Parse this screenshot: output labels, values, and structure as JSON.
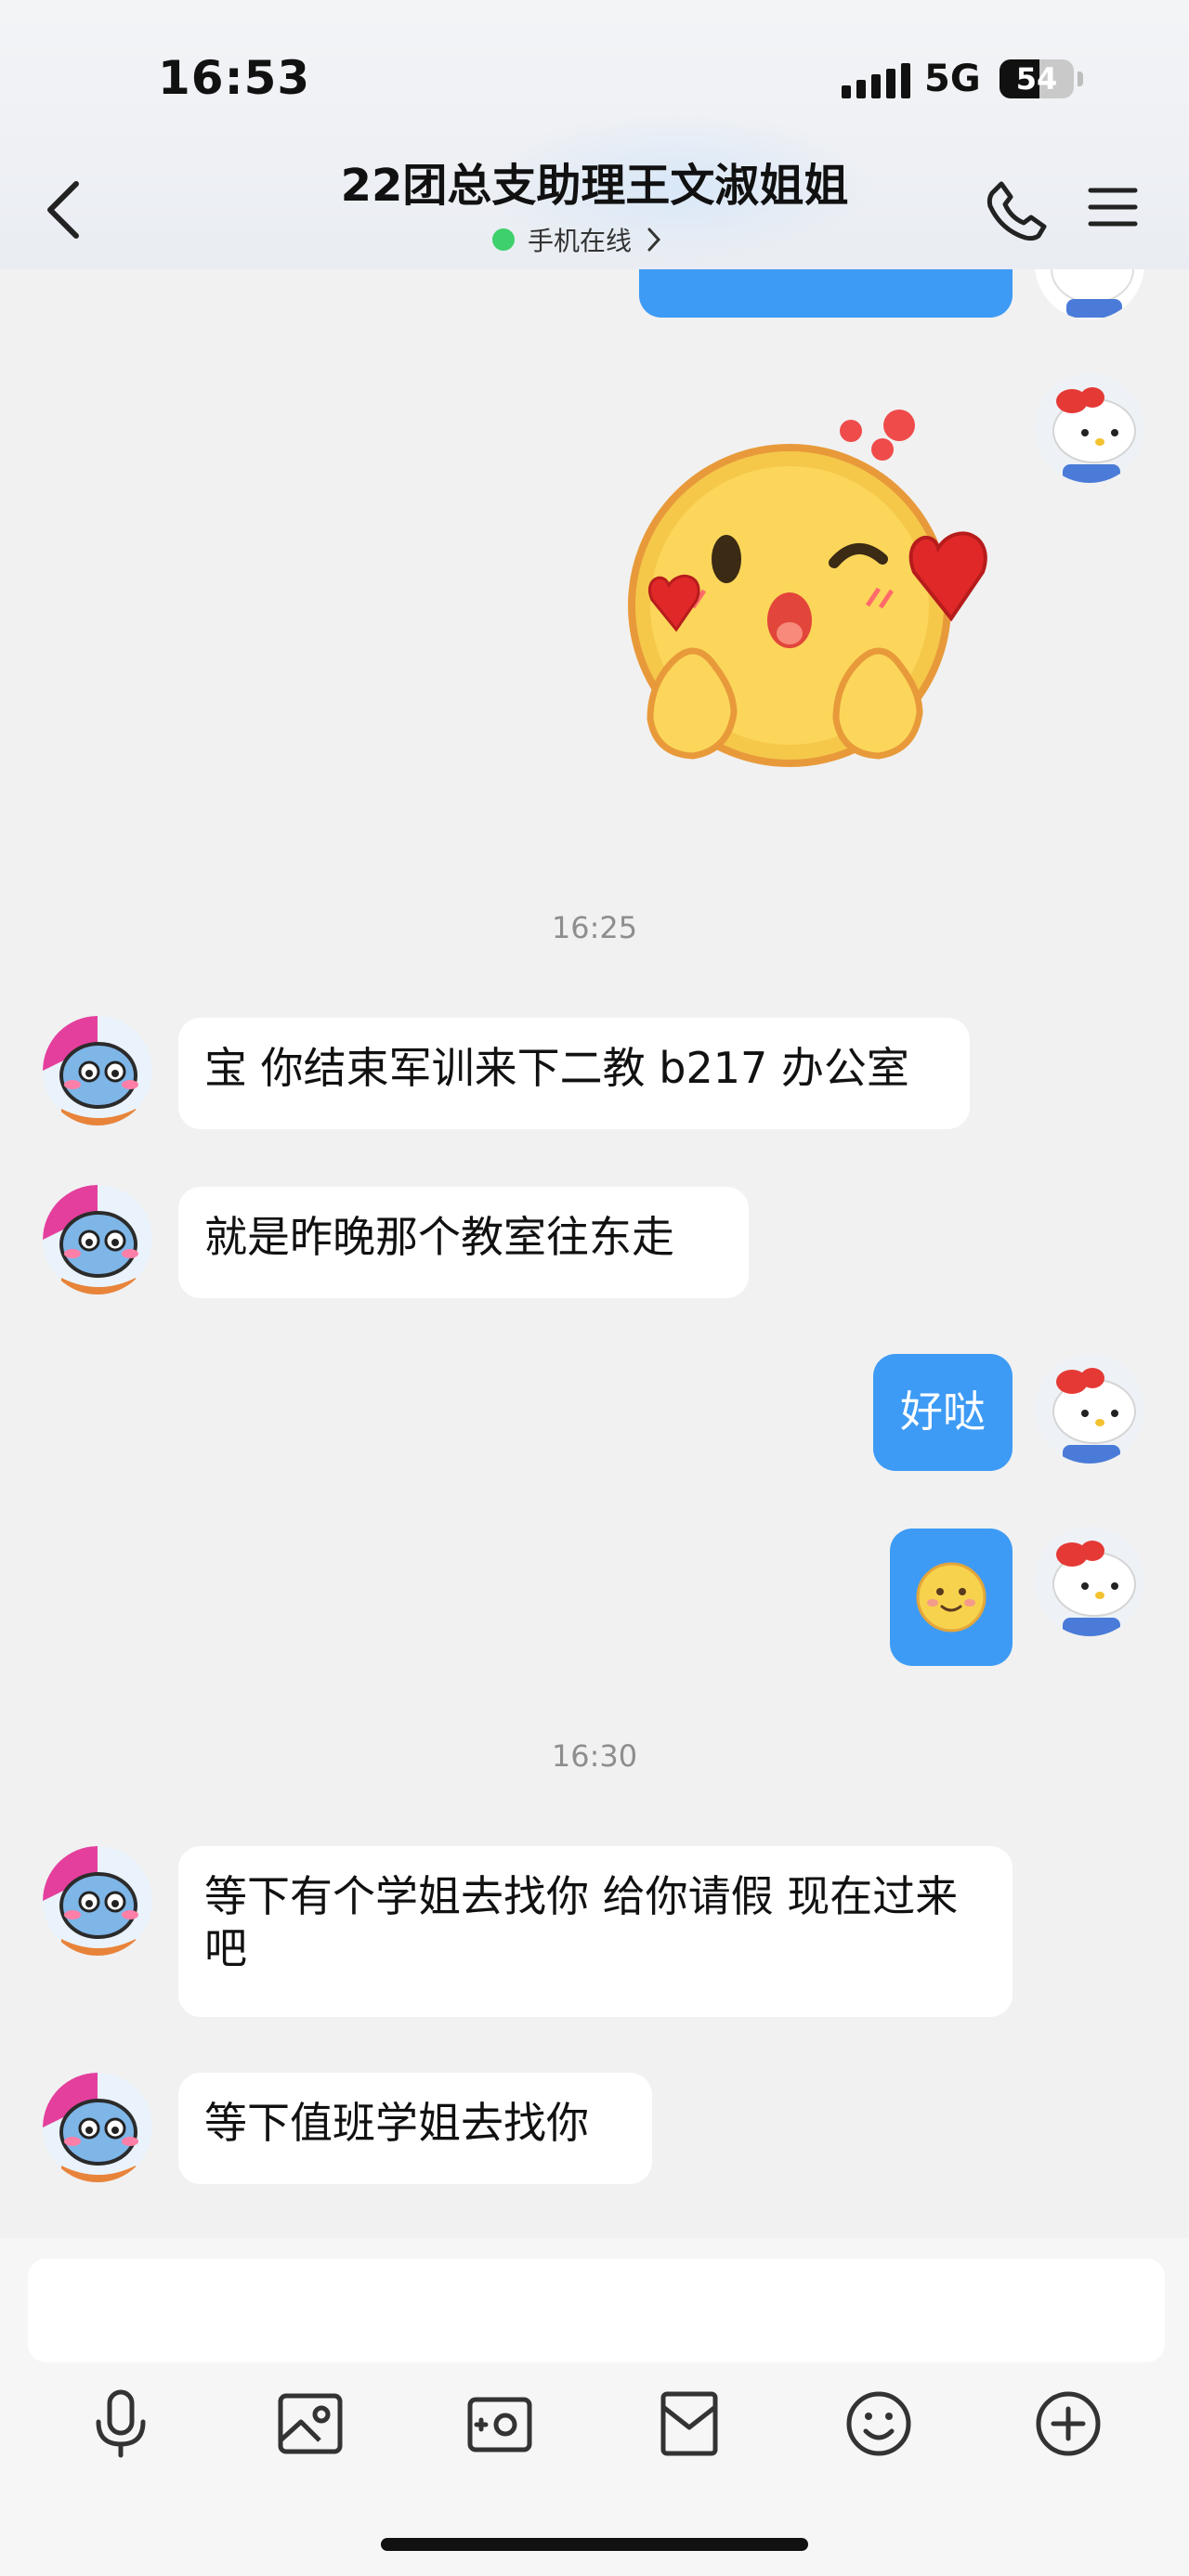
{
  "status": {
    "time": "16:53",
    "network": "5G",
    "battery": "54",
    "battery_level": 0.54
  },
  "header": {
    "title": "22团总支助理王文淑姐姐",
    "presence": "手机在线"
  },
  "messages": [
    {
      "type": "stamp",
      "text": "16:25"
    },
    {
      "type": "text",
      "side": "left",
      "text": "宝 你结束军训来下二教 b217 办公室"
    },
    {
      "type": "text",
      "side": "left",
      "text": "就是昨晚那个教室往东走"
    },
    {
      "type": "text",
      "side": "right",
      "text": "好哒"
    },
    {
      "type": "emoji",
      "side": "right",
      "emoji": "smiling-face"
    },
    {
      "type": "stamp",
      "text": "16:30"
    },
    {
      "type": "text",
      "side": "left",
      "text": "等下有个学姐去找你 给你请假 现在过来吧"
    },
    {
      "type": "text",
      "side": "left",
      "text": "等下值班学姐去找你"
    }
  ],
  "stickers": [
    {
      "name": "wink-heart-sticker"
    }
  ],
  "input": {
    "placeholder": ""
  },
  "toolbar": [
    "microphone-icon",
    "image-icon",
    "camera-icon",
    "red-packet-icon",
    "emoji-icon",
    "plus-icon"
  ],
  "colors": {
    "bubble_mine": "#3d9bf5",
    "bubble_other": "#ffffff",
    "background": "#f1f1f1",
    "online": "#3ed06c"
  }
}
